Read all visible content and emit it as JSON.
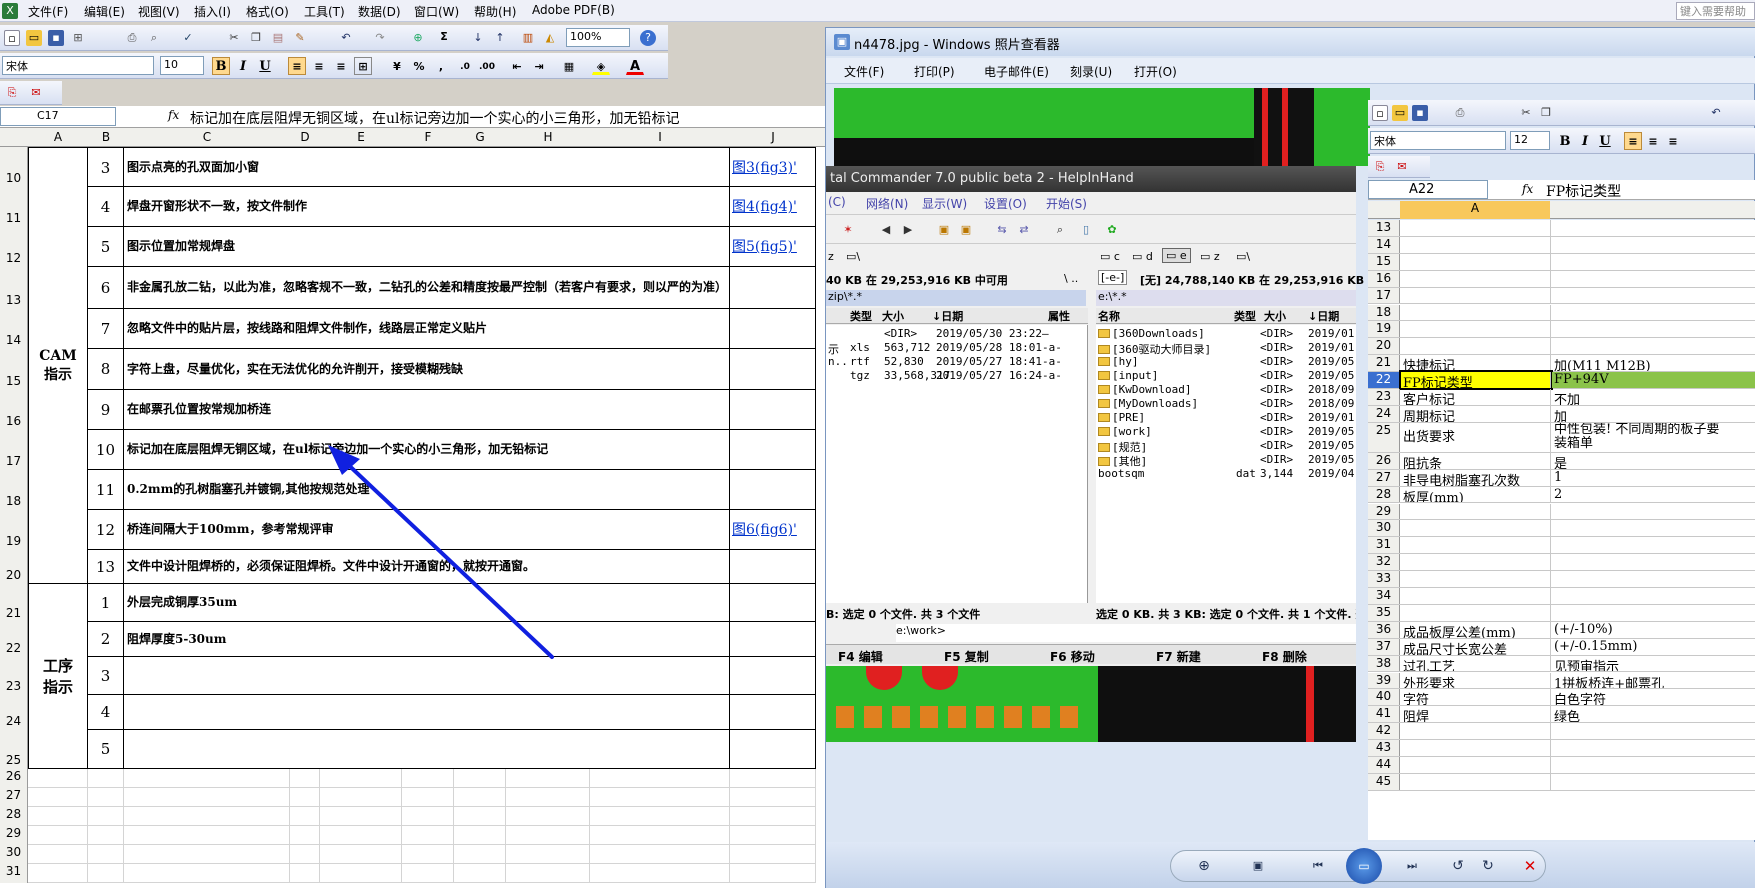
{
  "excel": {
    "menu": [
      "文件(F)",
      "编辑(E)",
      "视图(V)",
      "插入(I)",
      "格式(O)",
      "工具(T)",
      "数据(D)",
      "窗口(W)",
      "帮助(H)",
      "Adobe PDF(B)"
    ],
    "zoom": "100%",
    "font_name": "宋体",
    "font_size": "10",
    "cell_ref": "C17",
    "fx": "fx",
    "formula": "标记加在底层阻焊无铜区域，在ul标记旁边加一个实心的小三角形，加无铅标记",
    "columns": [
      "A",
      "B",
      "C",
      "D",
      "E",
      "F",
      "G",
      "H",
      "I",
      "J"
    ],
    "section_cam": "CAM\n指示",
    "section_proc": "工序\n指示",
    "rows": [
      {
        "row": "10",
        "num": "3",
        "desc": "图示点亮的孔双面加小窗",
        "link": "图3(fig3)'"
      },
      {
        "row": "11",
        "num": "4",
        "desc": "焊盘开窗形状不一致，按文件制作",
        "link": "图4(fig4)'"
      },
      {
        "row": "12",
        "num": "5",
        "desc": "图示位置加常规焊盘",
        "link": "图5(fig5)'"
      },
      {
        "row": "13",
        "num": "6",
        "desc": "非金属孔放二钻，以此为准，忽略客规不一致，二钻孔的公差和精度按最严控制（若客户有要求，则以严的为准）",
        "link": ""
      },
      {
        "row": "14",
        "num": "7",
        "desc": "忽略文件中的贴片层，按线路和阻焊文件制作，线路层正常定义贴片",
        "link": ""
      },
      {
        "row": "15",
        "num": "8",
        "desc": "字符上盘，尽量优化，实在无法优化的允许削开，接受模糊残缺",
        "link": ""
      },
      {
        "row": "16",
        "num": "9",
        "desc": "在邮票孔位置按常规加桥连",
        "link": ""
      },
      {
        "row": "17",
        "num": "10",
        "desc": "标记加在底层阻焊无铜区域，在ul标记旁边加一个实心的小三角形，加无铅标记",
        "link": ""
      },
      {
        "row": "18",
        "num": "11",
        "desc": "0.2mm的孔树脂塞孔并镀铜,其他按规范处理",
        "link": ""
      },
      {
        "row": "19",
        "num": "12",
        "desc": "桥连间隔大于100mm，参考常规评审",
        "link": "图6(fig6)'"
      },
      {
        "row": "20",
        "num": "13",
        "desc": "文件中设计阻焊桥的，必须保证阻焊桥。文件中设计开通窗的，就按开通窗。",
        "link": ""
      },
      {
        "row": "21",
        "num": "1",
        "desc": "外层完成铜厚35um",
        "link": ""
      },
      {
        "row": "22",
        "num": "2",
        "desc": "阻焊厚度5-30um",
        "link": ""
      },
      {
        "row": "23",
        "num": "3",
        "desc": "",
        "link": ""
      },
      {
        "row": "24",
        "num": "4",
        "desc": "",
        "link": ""
      },
      {
        "row": "25",
        "num": "5",
        "desc": "",
        "link": ""
      }
    ],
    "empty_rows": [
      "26",
      "27",
      "28",
      "29",
      "30",
      "31"
    ]
  },
  "viewer": {
    "title": "n4478.jpg - Windows 照片查看器",
    "menu": [
      "文件(F)",
      "打印(P)",
      "电子邮件(E)",
      "刻录(U)",
      "打开(O)"
    ],
    "search_hint": "键入需要帮助"
  },
  "tc": {
    "title": "tal Commander 7.0 public beta 2 - HelpInHand",
    "menu": [
      "(C)",
      "网络(N)",
      "显示(W)",
      "设置(O)",
      "开始(S)"
    ],
    "left_free": "40 KB 在 29,253,916 KB 中可用",
    "left_path": "zip\\*.*",
    "right_drive": "[-e-]",
    "right_free": "[无] 24,788,140 KB 在 29,253,916 KB 中",
    "right_path": "e:\\*.*",
    "left_headers": [
      "类型",
      "大小",
      "↓日期",
      "属性"
    ],
    "right_headers": [
      "名称",
      "类型",
      "大小",
      "↓日期"
    ],
    "left_files": [
      [
        "",
        "",
        "<DIR>",
        "2019/05/30 23:22—"
      ],
      [
        "示",
        "xls",
        "563,712",
        "2019/05/28 18:01-a-"
      ],
      [
        "n..",
        "rtf",
        "52,830",
        "2019/05/27 18:41-a-"
      ],
      [
        "",
        "tgz",
        "33,568,317",
        "2019/05/27 16:24-a-"
      ]
    ],
    "right_files": [
      [
        "[360Downloads]",
        "",
        "<DIR>",
        "2019/01"
      ],
      [
        "[360驱动大师目录]",
        "",
        "<DIR>",
        "2019/01"
      ],
      [
        "[hy]",
        "",
        "<DIR>",
        "2019/05"
      ],
      [
        "[input]",
        "",
        "<DIR>",
        "2019/05"
      ],
      [
        "[KwDownload]",
        "",
        "<DIR>",
        "2018/09"
      ],
      [
        "[MyDownloads]",
        "",
        "<DIR>",
        "2018/09"
      ],
      [
        "[PRE]",
        "",
        "<DIR>",
        "2019/01"
      ],
      [
        "[work]",
        "",
        "<DIR>",
        "2019/05"
      ],
      [
        "[规范]",
        "",
        "<DIR>",
        "2019/05"
      ],
      [
        "[其他]",
        "",
        "<DIR>",
        "2019/05"
      ],
      [
        "bootsqm",
        "dat",
        "3,144",
        "2019/04"
      ]
    ],
    "left_status": "B: 选定 0 个文件. 共 3 个文件",
    "right_status": "选定 0 KB. 共 3 KB: 选定 0 个文件. 共 1 个文件. 选",
    "cmdline": "e:\\work>",
    "fkeys": [
      "F4 编辑",
      "F5 复制",
      "F6 移动",
      "F7 新建",
      "F8 删除"
    ]
  },
  "right_excel": {
    "font_name": "宋体",
    "font_size": "12",
    "cell_ref": "A22",
    "formula": "FP标记类型",
    "col": "A",
    "rows": [
      [
        "13",
        "",
        ""
      ],
      [
        "14",
        "",
        ""
      ],
      [
        "15",
        "",
        ""
      ],
      [
        "16",
        "",
        ""
      ],
      [
        "17",
        "",
        ""
      ],
      [
        "18",
        "",
        ""
      ],
      [
        "19",
        "",
        ""
      ],
      [
        "20",
        "",
        ""
      ],
      [
        "21",
        "快捷标记",
        "加(M11 M12B)"
      ],
      [
        "22",
        "FP标记类型",
        "FP+94V"
      ],
      [
        "23",
        "客户标记",
        "不加"
      ],
      [
        "24",
        "周期标记",
        "加"
      ],
      [
        "25",
        "出货要求",
        "中性包装! 不同周期的板子要"
      ],
      [
        "26",
        "阻抗条",
        "是"
      ],
      [
        "27",
        "非导电树脂塞孔次数",
        "1"
      ],
      [
        "28",
        "板厚(mm)",
        "2"
      ],
      [
        "29",
        "",
        ""
      ],
      [
        "30",
        "",
        ""
      ],
      [
        "31",
        "",
        ""
      ],
      [
        "32",
        "",
        ""
      ],
      [
        "33",
        "",
        ""
      ],
      [
        "34",
        "",
        ""
      ],
      [
        "35",
        "",
        ""
      ],
      [
        "36",
        "成品板厚公差(mm)",
        "(+/-10%)"
      ],
      [
        "37",
        "成品尺寸长宽公差",
        "(+/-0.15mm)"
      ],
      [
        "38",
        "过孔工艺",
        "见预审指示"
      ],
      [
        "39",
        "外形要求",
        "1拼板桥连+邮票孔"
      ],
      [
        "40",
        "字符",
        "白色字符"
      ],
      [
        "41",
        "阻焊",
        "绿色"
      ],
      [
        "42",
        "",
        ""
      ],
      [
        "43",
        "",
        ""
      ],
      [
        "44",
        "",
        ""
      ],
      [
        "45",
        "",
        ""
      ]
    ],
    "row25_line2": "装箱单"
  }
}
